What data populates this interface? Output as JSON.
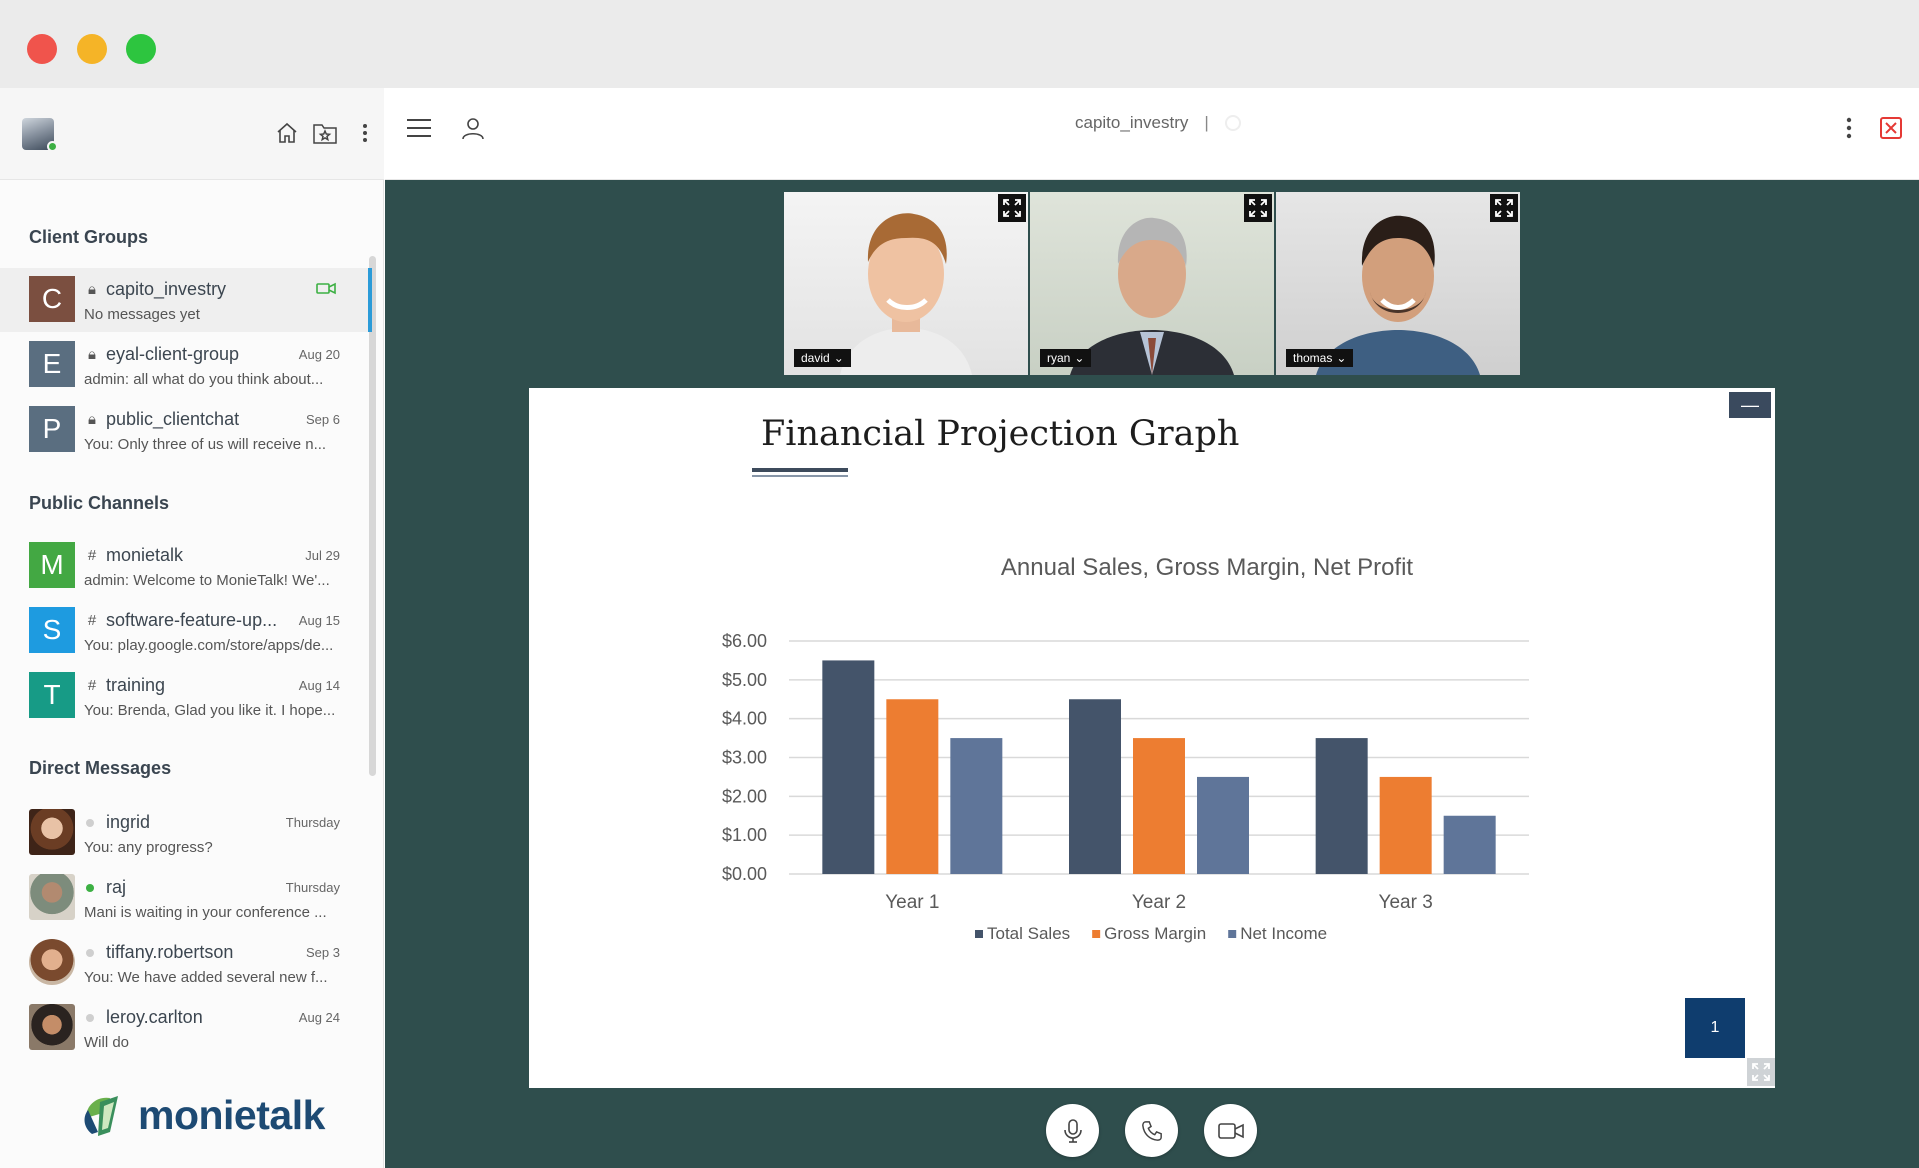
{
  "window": {
    "controls": [
      "close",
      "minimize",
      "maximize"
    ]
  },
  "sidebar": {
    "header_icons": [
      "home-icon",
      "starred-folder-icon",
      "more-vertical-icon"
    ],
    "sections": {
      "client_groups": "Client Groups",
      "public_channels": "Public Channels",
      "direct_messages": "Direct Messages"
    },
    "client_groups": [
      {
        "letter": "C",
        "name": "capito_investry",
        "date": "",
        "preview": "No messages yet",
        "color": "#7b4f40",
        "icon": "lock-icon",
        "active": true
      },
      {
        "letter": "E",
        "name": "eyal-client-group",
        "date": "Aug 20",
        "preview": "admin: all what do you think about...",
        "color": "#5a6e80",
        "icon": "lock-icon"
      },
      {
        "letter": "P",
        "name": "public_clientchat",
        "date": "Sep 6",
        "preview": "You: Only three of us will receive n...",
        "color": "#5a6e80",
        "icon": "lock-icon"
      }
    ],
    "public_channels": [
      {
        "letter": "M",
        "name": "monietalk",
        "date": "Jul 29",
        "preview": "admin: Welcome to MonieTalk! We'...",
        "color": "#43a843",
        "icon": "hash-icon"
      },
      {
        "letter": "S",
        "name": "software-feature-up...",
        "date": "Aug 15",
        "preview": "You: play.google.com/store/apps/de...",
        "color": "#1e9be0",
        "icon": "hash-icon"
      },
      {
        "letter": "T",
        "name": "training",
        "date": "Aug 14",
        "preview": "You: Brenda, Glad you like it. I hope...",
        "color": "#179b86",
        "icon": "hash-icon"
      }
    ],
    "direct_messages": [
      {
        "name": "ingrid",
        "date": "Thursday",
        "preview": "You: any progress?",
        "online": false
      },
      {
        "name": "raj",
        "date": "Thursday",
        "preview": "Mani is waiting in your conference ...",
        "online": true
      },
      {
        "name": "tiffany.robertson",
        "date": "Sep 3",
        "preview": "You: We have added several new f...",
        "online": false
      },
      {
        "name": "leroy.carlton",
        "date": "Aug 24",
        "preview": "Will do",
        "online": false
      }
    ],
    "logo_text": "monietalk"
  },
  "topbar": {
    "title": "capito_investry",
    "separator": "|"
  },
  "participants": [
    {
      "name": "david"
    },
    {
      "name": "ryan"
    },
    {
      "name": "thomas"
    }
  ],
  "slide": {
    "title": "Financial Projection Graph",
    "minimize_label": "—",
    "page_number": "1"
  },
  "chart_data": {
    "type": "bar",
    "title": "Annual Sales, Gross Margin, Net Profit",
    "categories": [
      "Year 1",
      "Year 2",
      "Year 3"
    ],
    "series": [
      {
        "name": "Total Sales",
        "values": [
          5.5,
          4.5,
          3.5
        ],
        "color": "#44546a"
      },
      {
        "name": "Gross Margin",
        "values": [
          4.5,
          3.5,
          2.5
        ],
        "color": "#ed7d31"
      },
      {
        "name": "Net Income",
        "values": [
          3.5,
          2.5,
          1.5
        ],
        "color": "#5f7599"
      }
    ],
    "ylim": [
      0,
      6
    ],
    "yticks": [
      "$0.00",
      "$1.00",
      "$2.00",
      "$3.00",
      "$4.00",
      "$5.00",
      "$6.00"
    ],
    "grid": true,
    "legend_position": "bottom"
  },
  "controls": [
    "microphone-icon",
    "phone-icon",
    "video-camera-icon"
  ]
}
